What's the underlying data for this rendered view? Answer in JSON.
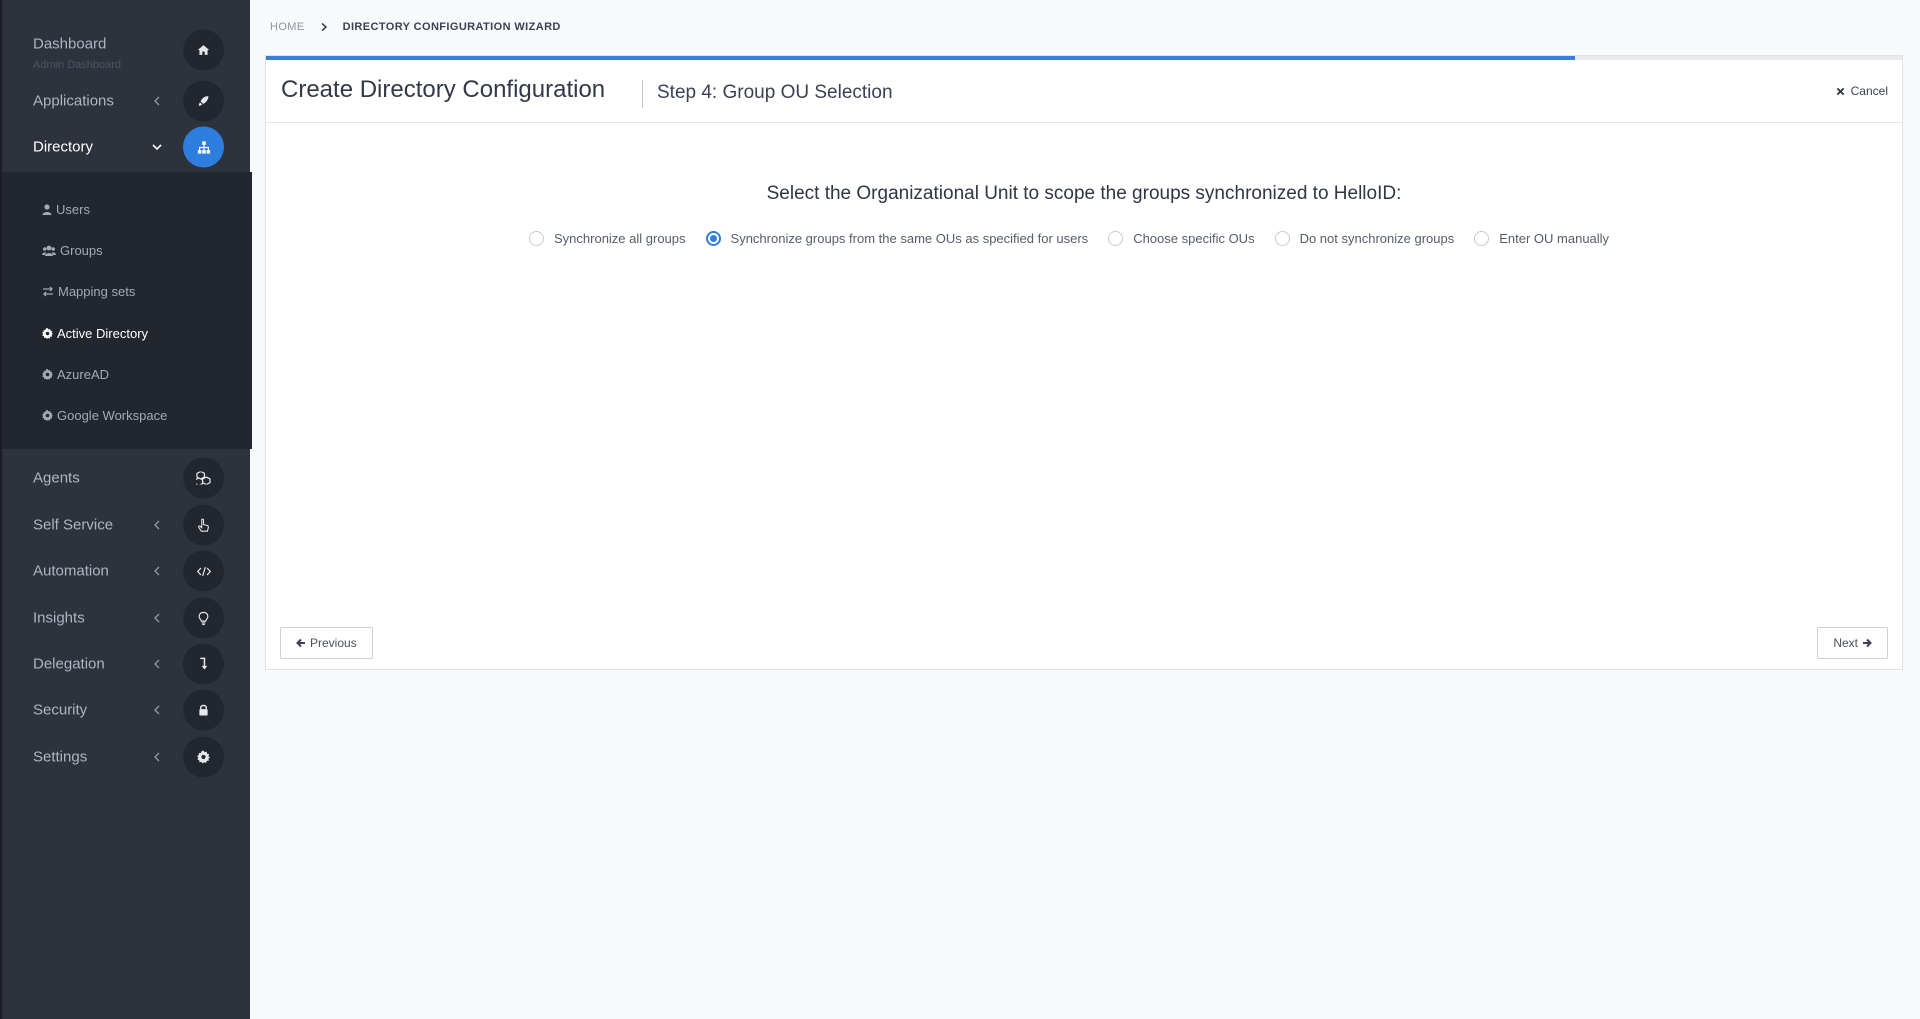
{
  "sidebar": {
    "dashboard": {
      "label": "Dashboard",
      "sublabel": "Admin Dashboard",
      "icon": "home-icon"
    },
    "applications": {
      "label": "Applications",
      "icon": "rocket-icon"
    },
    "directory": {
      "label": "Directory",
      "icon": "sitemap-icon",
      "items": [
        {
          "label": "Users",
          "icon": "user-icon"
        },
        {
          "label": "Groups",
          "icon": "users-icon"
        },
        {
          "label": "Mapping sets",
          "icon": "exchange-icon"
        },
        {
          "label": "Active Directory",
          "icon": "gear-icon"
        },
        {
          "label": "AzureAD",
          "icon": "gear-icon"
        },
        {
          "label": "Google Workspace",
          "icon": "gear-icon"
        }
      ]
    },
    "agents": {
      "label": "Agents",
      "icon": "cubes-icon"
    },
    "self_service": {
      "label": "Self Service",
      "icon": "pointer-hand-icon"
    },
    "automation": {
      "label": "Automation",
      "icon": "code-icon"
    },
    "insights": {
      "label": "Insights",
      "icon": "lightbulb-icon"
    },
    "delegation": {
      "label": "Delegation",
      "icon": "level-down-icon"
    },
    "security": {
      "label": "Security",
      "icon": "lock-icon"
    },
    "settings": {
      "label": "Settings",
      "icon": "gear-icon"
    }
  },
  "breadcrumb": {
    "home": "HOME",
    "current": "DIRECTORY CONFIGURATION WIZARD"
  },
  "wizard": {
    "title": "Create Directory Configuration",
    "step": "Step 4: Group OU Selection",
    "cancel": "Cancel",
    "progress": 0.8,
    "prompt": "Select the Organizational Unit to scope the groups synchronized to HelloID:",
    "options": [
      {
        "label": "Synchronize all groups",
        "checked": false
      },
      {
        "label": "Synchronize groups from the same OUs as specified for users",
        "checked": true
      },
      {
        "label": "Choose specific OUs",
        "checked": false
      },
      {
        "label": "Do not synchronize groups",
        "checked": false
      },
      {
        "label": "Enter OU manually",
        "checked": false
      }
    ],
    "previous": "Previous",
    "next": "Next"
  },
  "colors": {
    "accent": "#2e7ee0",
    "sidebar_bg": "#2d323d",
    "sidebar_sub_bg": "#22262e",
    "progress": "#3a7fd5"
  }
}
